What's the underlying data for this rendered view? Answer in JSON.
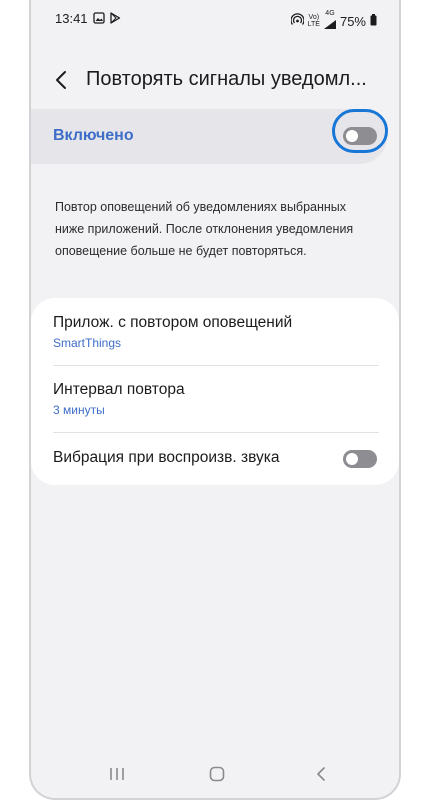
{
  "status_bar": {
    "time": "13:41",
    "network_top": "Vo)",
    "network_bottom": "LTE",
    "signal_label": "4G",
    "battery": "75%"
  },
  "header": {
    "title": "Повторять сигналы уведомл..."
  },
  "master_switch": {
    "label": "Включено",
    "state": "off"
  },
  "description": "Повтор оповещений об уведомлениях выбранных ниже приложений. После отклонения уведомления оповещение больше не будет повторяться.",
  "settings": {
    "apps": {
      "title": "Прилож. с повтором оповещений",
      "value": "SmartThings"
    },
    "interval": {
      "title": "Интервал повтора",
      "value": "3 минуты"
    },
    "vibration": {
      "title": "Вибрация при воспроизв. звука",
      "state": "off"
    }
  },
  "colors": {
    "accent": "#3e6ec8",
    "focus_ring": "#1877d6",
    "switch_off": "#8d8d92",
    "background": "#f2f2f4"
  },
  "icons": {
    "status_left": [
      "gallery-icon",
      "play-store-icon"
    ],
    "status_right": [
      "hotspot-icon",
      "signal-icon",
      "battery-icon"
    ],
    "nav": [
      "recent-apps-icon",
      "home-icon",
      "back-icon"
    ]
  }
}
